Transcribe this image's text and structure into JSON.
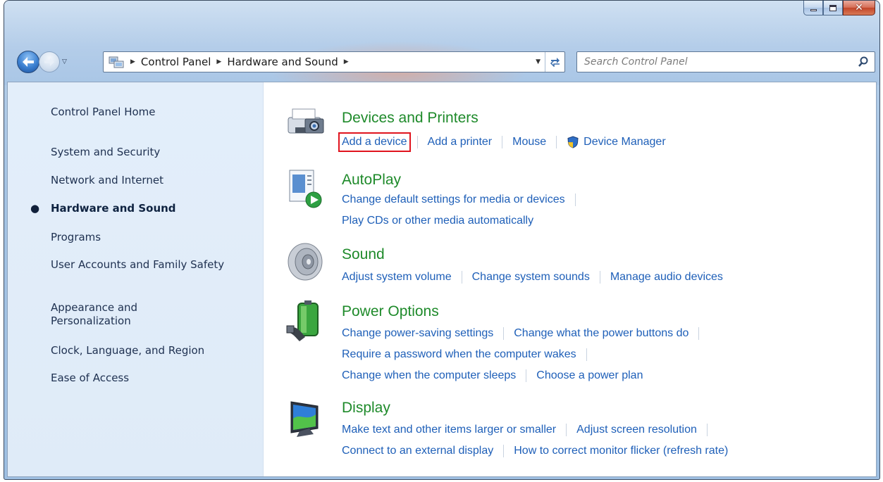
{
  "breadcrumbs": [
    "Control Panel",
    "Hardware and Sound"
  ],
  "search": {
    "placeholder": "Search Control Panel"
  },
  "sidebar": {
    "items": [
      {
        "label": "Control Panel Home"
      },
      {
        "label": "System and Security"
      },
      {
        "label": "Network and Internet"
      },
      {
        "label": "Hardware and Sound",
        "active": true
      },
      {
        "label": "Programs"
      },
      {
        "label": "User Accounts and Family Safety"
      },
      {
        "label": "Appearance and Personalization"
      },
      {
        "label": "Clock, Language, and Region"
      },
      {
        "label": "Ease of Access"
      }
    ]
  },
  "categories": [
    {
      "title": "Devices and Printers",
      "icon": "printer-camera-icon",
      "rows": [
        [
          "Add a device",
          "Add a printer",
          "Mouse",
          "Device Manager"
        ]
      ]
    },
    {
      "title": "AutoPlay",
      "icon": "autoplay-icon",
      "rows": [
        [
          "Change default settings for media or devices"
        ],
        [
          "Play CDs or other media automatically"
        ]
      ]
    },
    {
      "title": "Sound",
      "icon": "speaker-icon",
      "rows": [
        [
          "Adjust system volume",
          "Change system sounds",
          "Manage audio devices"
        ]
      ]
    },
    {
      "title": "Power Options",
      "icon": "battery-icon",
      "rows": [
        [
          "Change power-saving settings",
          "Change what the power buttons do"
        ],
        [
          "Require a password when the computer wakes"
        ],
        [
          "Change when the computer sleeps",
          "Choose a power plan"
        ]
      ]
    },
    {
      "title": "Display",
      "icon": "monitor-icon",
      "rows": [
        [
          "Make text and other items larger or smaller",
          "Adjust screen resolution"
        ],
        [
          "Connect to an external display",
          "How to correct monitor flicker (refresh rate)"
        ]
      ]
    }
  ],
  "colors": {
    "link": "#1e5fb8",
    "category_title": "#1e8a2a",
    "highlight": "#e0141e",
    "sidebar_bg": "#e3eefa"
  }
}
